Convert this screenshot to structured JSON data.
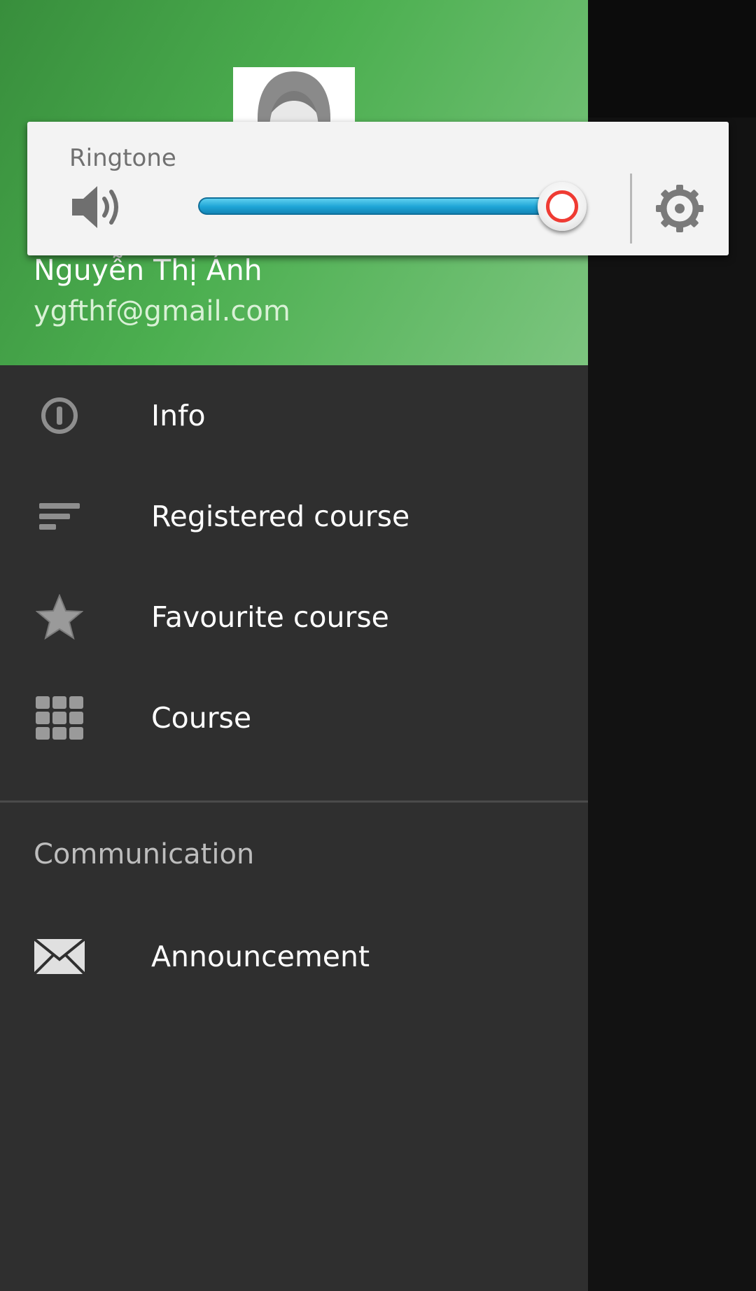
{
  "colors": {
    "header_green": "#4caf50",
    "drawer_bg": "#2f2f2f",
    "slider_blue": "#1da4d6",
    "thumb_ring": "#ef3b33"
  },
  "profile": {
    "avatar_icon": "user-avatar",
    "name": "Nguyễn Thị Ánh",
    "email": "ygfthf@gmail.com"
  },
  "menu": {
    "items": [
      {
        "label": "Info",
        "icon": "info-icon"
      },
      {
        "label": "Registered course",
        "icon": "sort-list-icon"
      },
      {
        "label": "Favourite course",
        "icon": "star-icon"
      },
      {
        "label": "Course",
        "icon": "grid-icon"
      }
    ],
    "section_header": "Communication",
    "communication_items": [
      {
        "label": "Announcement",
        "icon": "envelope-icon"
      }
    ]
  },
  "volume_panel": {
    "stream_label": "Ringtone",
    "level_fraction": 1.0,
    "speaker_icon": "speaker-icon",
    "settings_icon": "gear-icon"
  }
}
